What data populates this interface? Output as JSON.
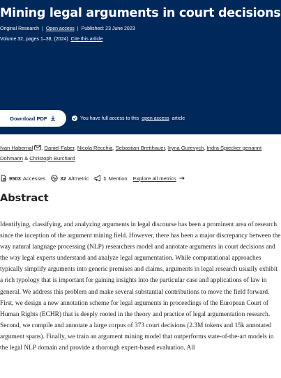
{
  "header": {
    "title": "Mining legal arguments in court decisions",
    "article_type": "Original Research",
    "open_access": "Open access",
    "published": "Published: 23 June 2023",
    "volume_info": "Volume 32, pages 1–38, (2024)",
    "cite_label": "Cite this article"
  },
  "actions": {
    "download_label": "Download PDF",
    "access_prefix": "You have full access to this",
    "access_link": "open access",
    "access_suffix": "article"
  },
  "authors": {
    "list": [
      "Ivan Habernal",
      "Daniel Faber",
      "Nicola Recchia",
      "Sebastian Bretthauer",
      "Iryna Gurevych",
      "Indra Spiecker genannt Döhmann",
      "Christoph Burchard"
    ],
    "ampersand": "&"
  },
  "metrics": {
    "accesses_count": "9503",
    "accesses_label": "Accesses",
    "altmetric_count": "32",
    "altmetric_label": "Altmetric",
    "mentions_count": "1",
    "mentions_label": "Mention",
    "explore_label": "Explore all metrics"
  },
  "abstract": {
    "heading": "Abstract",
    "text": "Identifying, classifying, and analyzing arguments in legal discourse has been a prominent area of research since the inception of the argument mining field. However, there has been a major discrepancy between the way natural language processing (NLP) researchers model and annotate arguments in court decisions and the way legal experts understand and analyze legal argumentation. While computational approaches typically simplify arguments into generic premises and claims, arguments in legal research usually exhibit a rich typology that is important for gaining insights into the particular case and applications of law in general. We address this problem and make several substantial contributions to move the field forward. First, we design a new annotation scheme for legal arguments in proceedings of the European Court of Human Rights (ECHR) that is deeply rooted in the theory and practice of legal argumentation research. Second, we compile and annotate a large corpus of 373 court decisions (2.3M tokens and 15k annotated argument spans). Finally, we train an argument mining model that outperforms state-of-the-art models in the legal NLP domain and provide a thorough expert-based evaluation. All"
  },
  "colors": {
    "header_bg": "#00285a",
    "text": "#222222",
    "white": "#ffffff"
  }
}
